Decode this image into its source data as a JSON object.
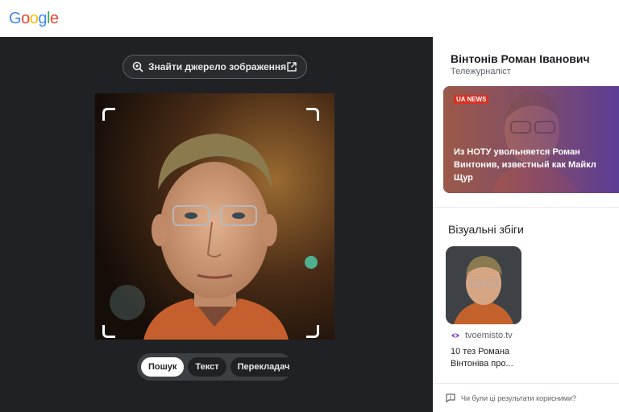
{
  "header": {
    "logo": {
      "letters": [
        "G",
        "o",
        "o",
        "g",
        "l",
        "e"
      ],
      "colors": [
        "#4285F4",
        "#EA4335",
        "#FBBC05",
        "#4285F4",
        "#34A853",
        "#EA4335"
      ]
    }
  },
  "viewer": {
    "source_button_label": "Знайти джерело зображення",
    "modes": [
      {
        "label": "Пошук",
        "active": true
      },
      {
        "label": "Текст",
        "active": false
      },
      {
        "label": "Перекладач",
        "active": false
      }
    ]
  },
  "knowledge_panel": {
    "name": "Вінтонів Роман Іванович",
    "subtitle": "Тележурналіст",
    "card": {
      "badge": "UA NEWS",
      "headline": "Из НОТУ увольняется Роман Винтонив, известный как Майкл Щур"
    }
  },
  "visual_matches": {
    "title": "Візуальні збіги",
    "items": [
      {
        "source": "tvoemisto.tv",
        "caption": "10 тез Романа Вінтоніва про..."
      }
    ]
  },
  "feedback": {
    "text": "Чи були ці результати корисними?"
  },
  "colors": {
    "dark_bg": "#202124",
    "accent_purple": "#7b3fe4",
    "active_mode_bg": "#ffffff"
  }
}
